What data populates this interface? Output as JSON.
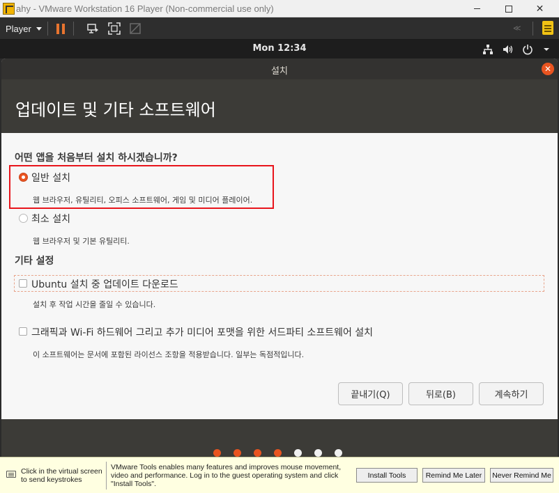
{
  "vmware": {
    "window_title": "ahy - VMware Workstation 16 Player (Non-commercial use only)",
    "close_glyph": "✕",
    "player_menu": "Player",
    "rewind_glyph": "≪"
  },
  "ubuntu_panel": {
    "clock": "Mon 12:34"
  },
  "installer": {
    "window_title": "설치",
    "close_glyph": "✕",
    "heading": "업데이트 및 기타 소프트웨어",
    "question": "어떤 앱을 처음부터 설치 하시겠습니까?",
    "options": [
      {
        "label": "일반 설치",
        "description": "웹 브라우저, 유틸리티, 오피스  소프트웨어, 게임 및 미디어 플레이어.",
        "selected": true
      },
      {
        "label": "최소 설치",
        "description": "웹 브라우저 및 기본 유틸리티.",
        "selected": false
      }
    ],
    "other_title": "기타 설정",
    "checks": [
      {
        "label": "Ubuntu 설치 중 업데이트 다운로드",
        "description": "설치 후 작업 시간을 줄일 수 있습니다.",
        "checked": false
      },
      {
        "label": "그래픽과 Wi-Fi 하드웨어 그리고 추가 미디어 포맷을 위한 서드파티 소프트웨어 설치",
        "description": "이 소프트웨어는 문서에 포함된 라이선스 조항을 적용받습니다. 일부는 독점적입니다.",
        "checked": false
      }
    ],
    "buttons": {
      "quit": "끝내기(Q)",
      "back": "뒤로(B)",
      "continue": "계속하기"
    },
    "progress": {
      "completed_steps": 4,
      "total_steps": 7
    },
    "accent_color": "#e95420"
  },
  "tools_bar": {
    "hint": "Click in the virtual screen to send keystrokes",
    "message": "VMware Tools enables many features and improves mouse movement, video and performance. Log in to the guest operating system and click \"Install Tools\".",
    "install_btn": "Install Tools",
    "remind_later_btn": "Remind Me Later",
    "never_remind_btn": "Never Remind Me"
  }
}
